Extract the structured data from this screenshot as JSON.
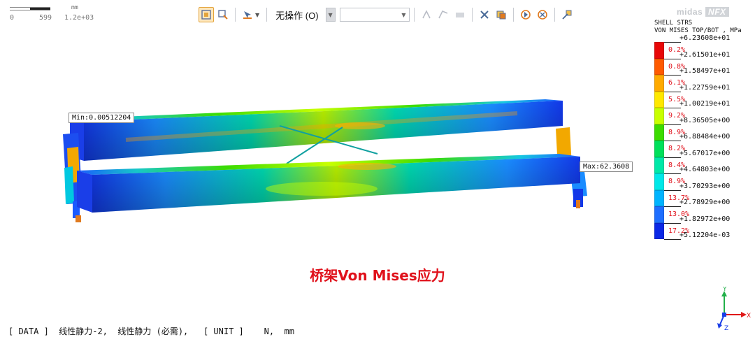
{
  "scalebar": {
    "unit": "mm",
    "ticks": [
      "0",
      "599",
      "1.2e+03"
    ]
  },
  "toolbar": {
    "operation_label": "无操作 (O)",
    "combo_value": "",
    "icons": [
      "fit-view-icon",
      "zoom-window-icon",
      "select-icon",
      "node-icon",
      "element-icon",
      "plate-icon",
      "cancel-selection-icon",
      "display-mode-icon",
      "shading-icon",
      "rotate-icon",
      "pan-icon",
      "zoom-icon"
    ]
  },
  "logo": {
    "text": "midas",
    "product": "NFX"
  },
  "legend": {
    "title_line1": "SHELL STRS",
    "title_line2": "VON MISES TOP/BOT , MPa",
    "values": [
      "+6.23608e+01",
      "+2.61501e+01",
      "+1.58497e+01",
      "+1.22759e+01",
      "+1.00219e+01",
      "+8.36505e+00",
      "+6.88484e+00",
      "+5.67017e+00",
      "+4.64803e+00",
      "+3.70293e+00",
      "+2.78929e+00",
      "+1.82972e+00",
      "+5.12204e-03"
    ],
    "percents": [
      "0.2%",
      "0.8%",
      "6.1%",
      "5.5%",
      "9.2%",
      "8.9%",
      "8.2%",
      "8.4%",
      "8.9%",
      "13.7%",
      "13.0%",
      "17.2%"
    ],
    "colors": [
      "#e80808",
      "#ff5a00",
      "#ffaa00",
      "#ffe800",
      "#c8ff00",
      "#3cdc00",
      "#00e05a",
      "#00e8a8",
      "#00e8e8",
      "#00b4ff",
      "#1e6eff",
      "#0a28e6"
    ]
  },
  "callouts": {
    "min": "Min:0.00512204",
    "max": "Max:62.3608"
  },
  "caption": "桥架Von Mises应力",
  "status": "[ DATA ]  线性静力-2,  线性静力 (必需),   [ UNIT ]    N,  mm",
  "axes": {
    "x": "X",
    "y": "Y",
    "z": "Z"
  }
}
